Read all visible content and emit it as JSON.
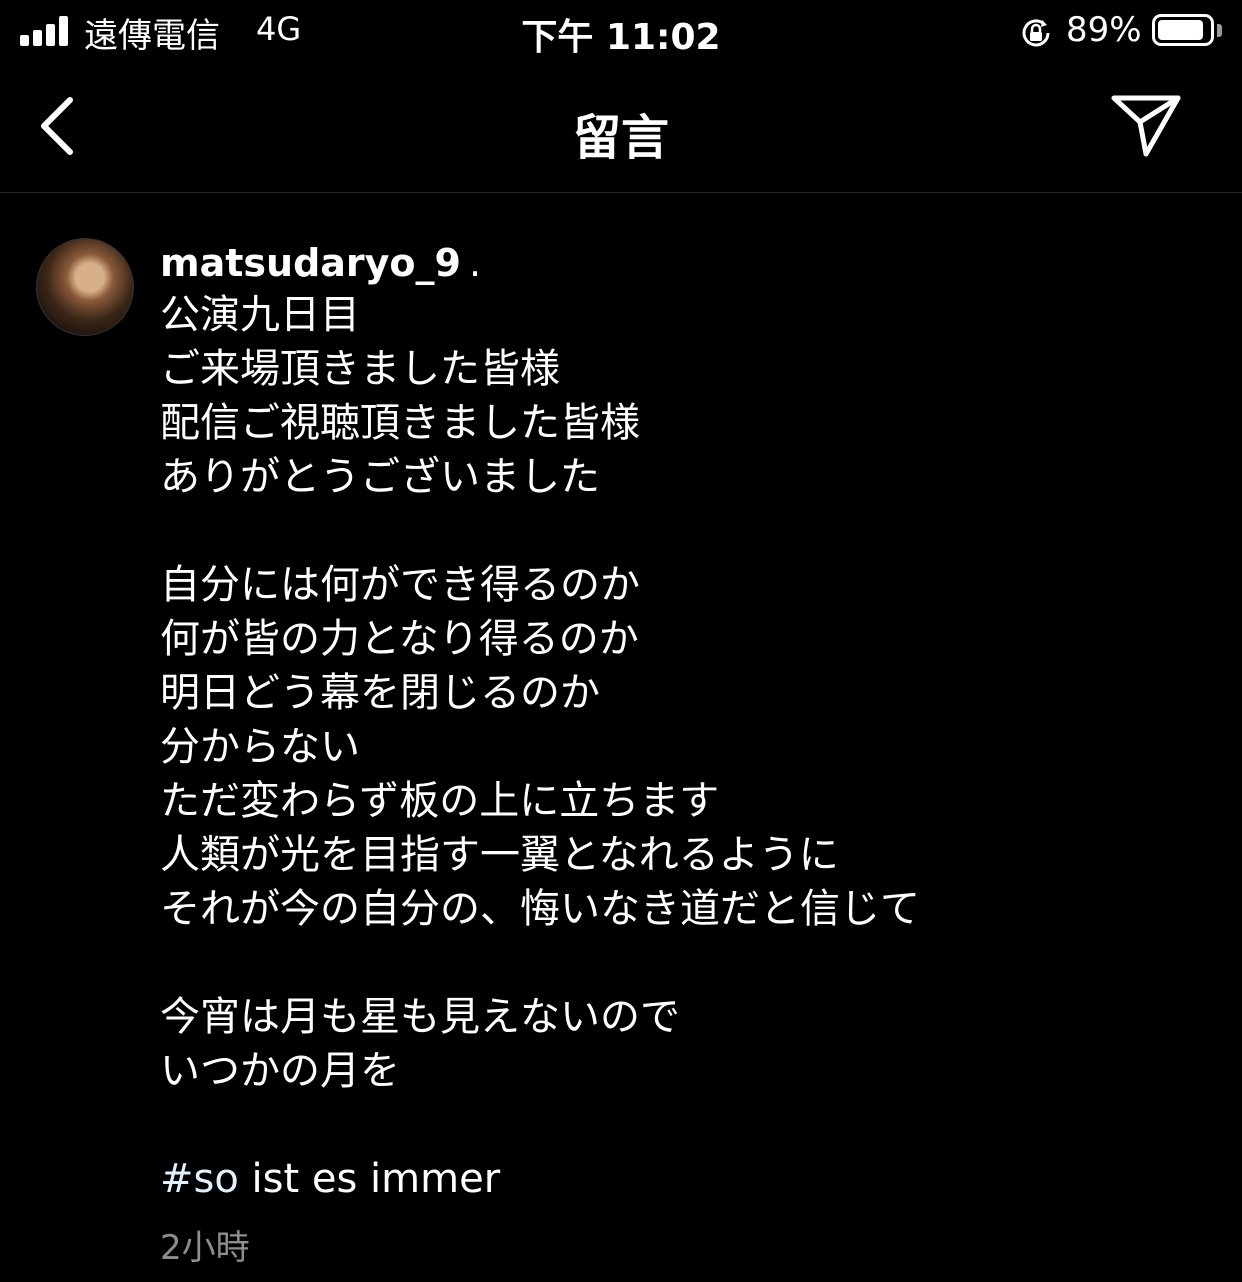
{
  "status_bar": {
    "carrier": "遠傳電信",
    "network": "4G",
    "time": "下午 11:02",
    "battery_percent": "89%",
    "battery_level": 0.89,
    "signal_bars_active": 4,
    "signal_bars_total": 4
  },
  "header": {
    "title": "留言",
    "back_icon": "chevron-left-icon",
    "share_icon": "send-icon"
  },
  "comment": {
    "username": "matsudaryo_9",
    "username_suffix": ".",
    "caption_lines": [
      "公演九日目",
      "ご来場頂きました皆様",
      "配信ご視聴頂きました皆様",
      "ありがとうございました",
      "",
      "自分には何ができ得るのか",
      "何が皆の力となり得るのか",
      "明日どう幕を閉じるのか",
      "分からない",
      "ただ変わらず板の上に立ちます",
      "人類が光を目指す一翼となれるように",
      "それが今の自分の、悔いなき道だと信じて",
      "",
      "今宵は月も星も見えないので",
      "いつかの月を",
      ""
    ],
    "hashtag": "#so",
    "hashtag_rest": " ist es immer",
    "timestamp": "2小時"
  },
  "colors": {
    "background": "#000000",
    "text": "#ffffff",
    "secondary": "#8e8e8e",
    "hashtag": "#e0f1ff"
  }
}
